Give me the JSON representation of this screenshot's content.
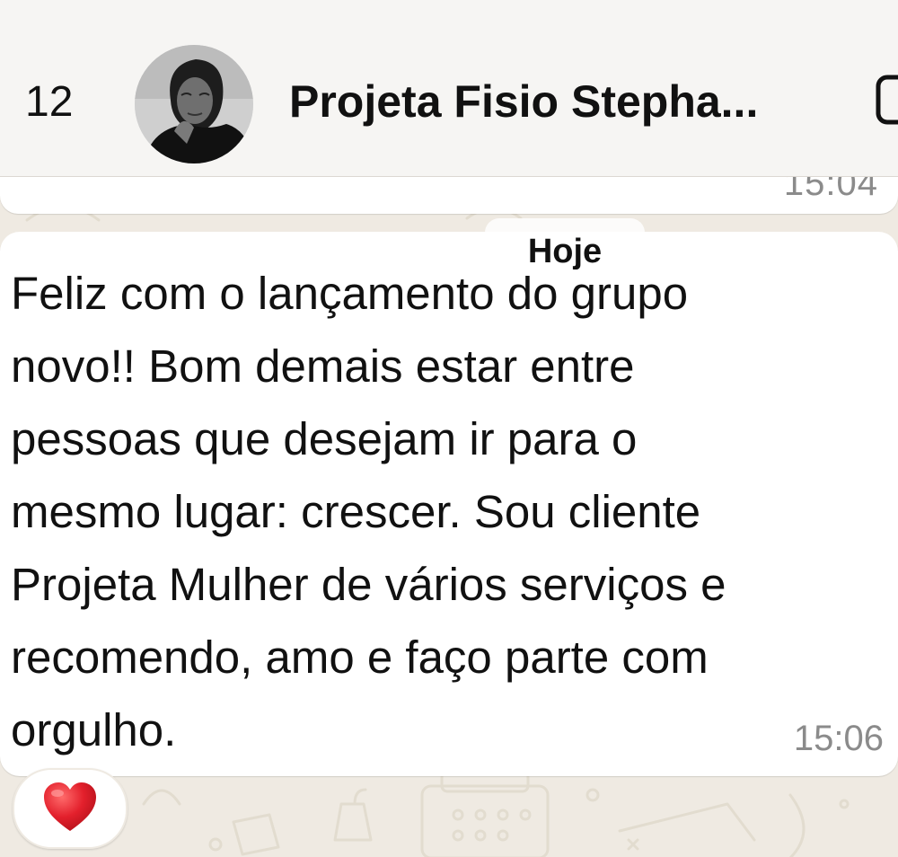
{
  "header": {
    "back_count": "12",
    "contact_name": "Projeta Fisio Stepha..."
  },
  "previous_message": {
    "time": "15:04"
  },
  "date_separator": "Hoje",
  "message": {
    "text": "Feliz com o lançamento do grupo\nnovo!! Bom demais estar entre\npessoas que desejam ir para o\nmesmo lugar: crescer. Sou cliente\nProjeta Mulher de vários serviços e\nrecomendo, amo e faço parte com\norgulho.",
    "time": "15:06",
    "reaction": "heart-emoji"
  },
  "colors": {
    "wallpaper": "#efeae2",
    "header_bg": "#f6f5f3",
    "bubble_bg": "#ffffff",
    "reaction_heart": "#e3202c",
    "timestamp": "#8b8b8b"
  }
}
